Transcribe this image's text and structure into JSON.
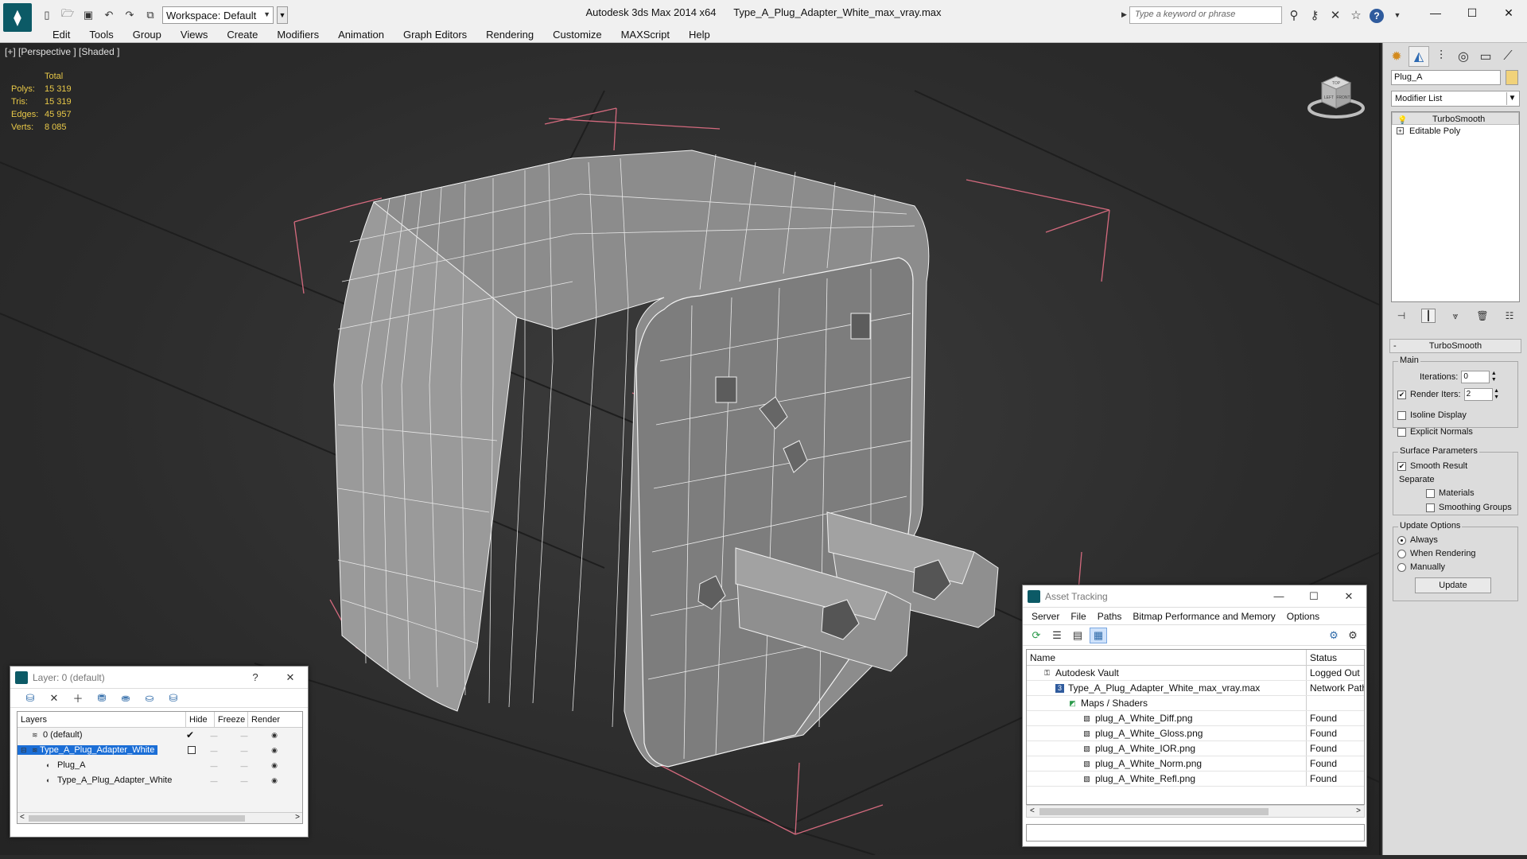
{
  "titlebar": {
    "workspace_label": "Workspace: Default",
    "app_title": "Autodesk 3ds Max  2014 x64",
    "file_title": "Type_A_Plug_Adapter_White_max_vray.max",
    "search_placeholder": "Type a keyword or phrase"
  },
  "menu": [
    "Edit",
    "Tools",
    "Group",
    "Views",
    "Create",
    "Modifiers",
    "Animation",
    "Graph Editors",
    "Rendering",
    "Customize",
    "MAXScript",
    "Help"
  ],
  "viewport": {
    "label": "[+] [Perspective ] [Shaded ]",
    "stats": {
      "header": "Total",
      "polys_label": "Polys:",
      "polys": "15 319",
      "tris_label": "Tris:",
      "tris": "15 319",
      "edges_label": "Edges:",
      "edges": "45 957",
      "verts_label": "Verts:",
      "verts": "8 085"
    },
    "viewcube_face_top": "TOP",
    "viewcube_face_left": "LEFT",
    "viewcube_face_front": "FRONT"
  },
  "command_panel": {
    "object_name": "Plug_A",
    "object_color": "#f1d27a",
    "modifier_list": "Modifier List",
    "stack": [
      "TurboSmooth",
      "Editable Poly"
    ],
    "rollout_title": "TurboSmooth",
    "main_group": "Main",
    "iterations_label": "Iterations:",
    "iterations": "0",
    "render_iters_label": "Render Iters:",
    "render_iters": "2",
    "isoline_label": "Isoline Display",
    "explicit_normals_label": "Explicit Normals",
    "surface_group": "Surface Parameters",
    "smooth_result_label": "Smooth Result",
    "separate_label": "Separate",
    "materials_label": "Materials",
    "smoothing_groups_label": "Smoothing Groups",
    "update_group": "Update Options",
    "always_label": "Always",
    "when_rendering_label": "When Rendering",
    "manually_label": "Manually",
    "update_button": "Update"
  },
  "layer_window": {
    "title": "Layer: 0 (default)",
    "help": "?",
    "col_layers": "Layers",
    "col_hide": "Hide",
    "col_freeze": "Freeze",
    "col_render": "Render",
    "rows": [
      {
        "name": "0 (default)"
      },
      {
        "name": "Type_A_Plug_Adapter_White"
      },
      {
        "name": "Plug_A"
      },
      {
        "name": "Type_A_Plug_Adapter_White"
      }
    ]
  },
  "asset_window": {
    "title": "Asset Tracking",
    "menu": [
      "Server",
      "File",
      "Paths",
      "Bitmap Performance and Memory",
      "Options"
    ],
    "col_name": "Name",
    "col_status": "Status",
    "rows": [
      {
        "name": "Autodesk Vault",
        "status": "Logged Out"
      },
      {
        "name": "Type_A_Plug_Adapter_White_max_vray.max",
        "status": "Network Path"
      },
      {
        "name": "Maps / Shaders",
        "status": ""
      },
      {
        "name": "plug_A_White_Diff.png",
        "status": "Found"
      },
      {
        "name": "plug_A_White_Gloss.png",
        "status": "Found"
      },
      {
        "name": "plug_A_White_IOR.png",
        "status": "Found"
      },
      {
        "name": "plug_A_White_Norm.png",
        "status": "Found"
      },
      {
        "name": "plug_A_White_Refl.png",
        "status": "Found"
      }
    ]
  }
}
